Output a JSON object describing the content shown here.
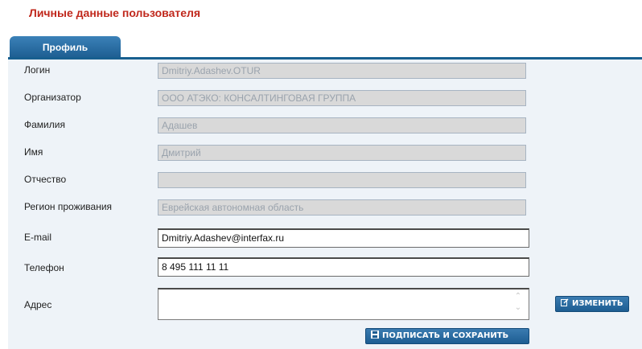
{
  "page": {
    "title": "Личные данные пользователя"
  },
  "tabs": [
    {
      "label": "Профиль",
      "active": true
    }
  ],
  "form": {
    "fields": [
      {
        "label": "Логин",
        "value": "Dmitriy.Adashev.OTUR",
        "editable": false
      },
      {
        "label": "Организатор",
        "value": "ООО АТЭКО: КОНСАЛТИНГОВАЯ ГРУППА",
        "editable": false
      },
      {
        "label": "Фамилия",
        "value": "Адашев",
        "editable": false
      },
      {
        "label": "Имя",
        "value": "Дмитрий",
        "editable": false
      },
      {
        "label": "Отчество",
        "value": "",
        "editable": false
      },
      {
        "label": "Регион проживания",
        "value": "Еврейская автономная область",
        "editable": false
      },
      {
        "label": "E-mail",
        "value": "Dmitriy.Adashev@interfax.ru",
        "editable": true
      },
      {
        "label": "Телефон",
        "value": "8 495 111 11 11",
        "editable": true
      }
    ],
    "address": {
      "label": "Адрес",
      "value": ""
    }
  },
  "buttons": {
    "edit_label": "ИЗМЕНИТЬ",
    "edit_icon": "edit-icon",
    "save_label": "ПОДПИСАТЬ И СОХРАНИТЬ",
    "save_icon": "floppy-disk-icon"
  },
  "colors": {
    "title": "#c0281c",
    "tab": "#1e5f93",
    "panel": "#eef3f8",
    "readonly_field": "#d9d9d9"
  }
}
